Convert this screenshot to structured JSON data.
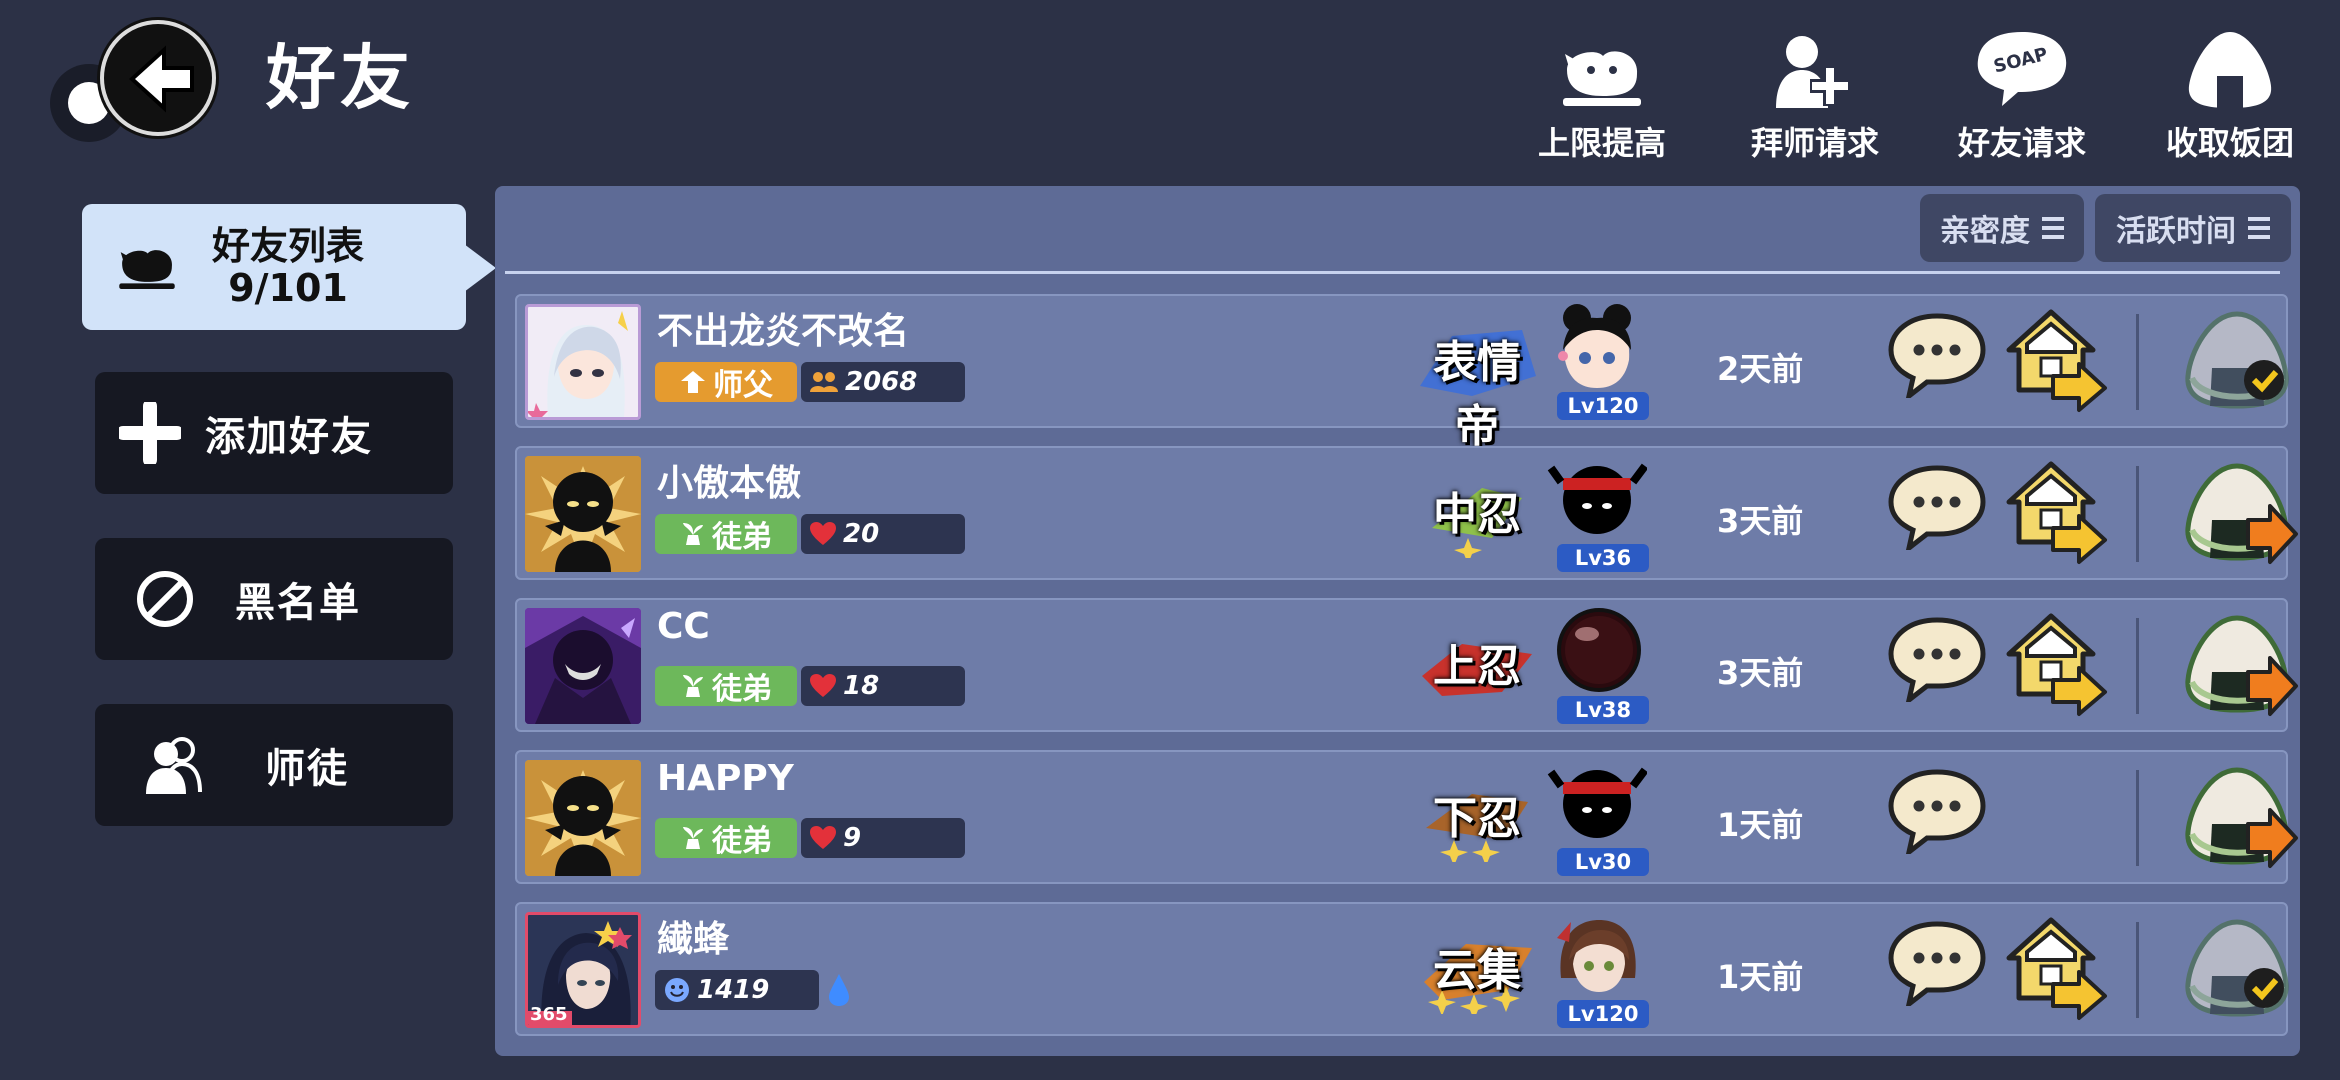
{
  "header": {
    "title": "好友",
    "actions": [
      {
        "label": "上限提高",
        "icon": "pet-icon"
      },
      {
        "label": "拜师请求",
        "icon": "add-person-icon"
      },
      {
        "label": "好友请求",
        "icon": "soap-speech-icon"
      },
      {
        "label": "收取饭团",
        "icon": "rice-ball-icon"
      }
    ]
  },
  "sidebar": {
    "active": {
      "label": "好友列表",
      "count": "9/101"
    },
    "items": [
      {
        "label": "添加好友",
        "icon": "plus-icon"
      },
      {
        "label": "黑名单",
        "icon": "block-icon"
      },
      {
        "label": "师徒",
        "icon": "mentor-icon"
      }
    ]
  },
  "sort": {
    "intimacy_label": "亲密度",
    "active_time_label": "活跃时间"
  },
  "friends": [
    {
      "name": "不出龙炎不改名",
      "role": "师父",
      "stat": "2068",
      "stat_icon": "group-icon",
      "rank": "表情帝",
      "level": "Lv120",
      "last_active": "2天前",
      "has_home": true,
      "rice": "collected"
    },
    {
      "name": "小傲本傲",
      "role": "徒弟",
      "stat": "20",
      "stat_icon": "heart-icon",
      "rank": "中忍",
      "level": "Lv36",
      "last_active": "3天前",
      "has_home": true,
      "rice": "send"
    },
    {
      "name": "CC",
      "role": "徒弟",
      "stat": "18",
      "stat_icon": "heart-icon",
      "rank": "上忍",
      "level": "Lv38",
      "last_active": "3天前",
      "has_home": true,
      "rice": "send"
    },
    {
      "name": "HAPPY",
      "role": "徒弟",
      "stat": "9",
      "stat_icon": "heart-icon",
      "rank": "下忍",
      "level": "Lv30",
      "last_active": "1天前",
      "has_home": false,
      "rice": "send"
    },
    {
      "name": "繊蜂",
      "role": "",
      "stat": "1419",
      "stat_icon": "smile-icon",
      "rank": "云集",
      "level": "Lv120",
      "last_active": "1天前",
      "has_home": true,
      "rice": "collected",
      "avatar_badge": "365"
    }
  ],
  "colors": {
    "background": "#2c3146",
    "panel": "#5e6b96",
    "row": "#6e7ca8",
    "master_badge": "#e59b2f",
    "pupil_badge": "#6db85b",
    "level_badge": "#2c5bc4",
    "active_tab": "#d2e3f9"
  }
}
